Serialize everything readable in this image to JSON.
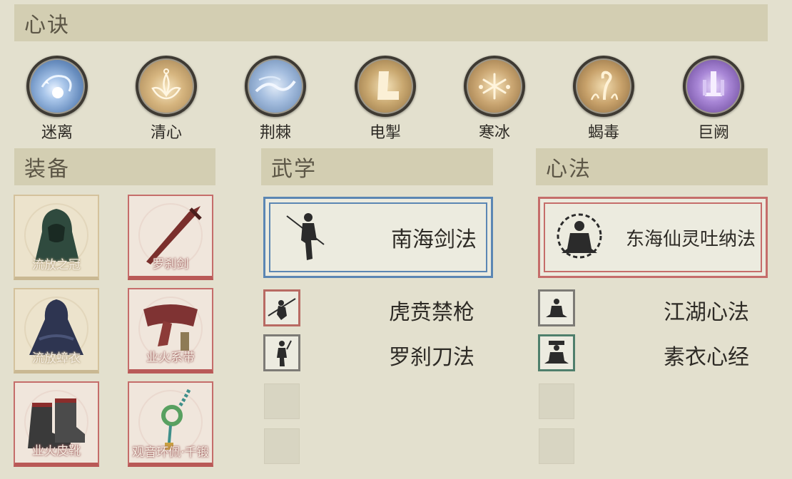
{
  "sections": {
    "xinjue": "心诀",
    "zhuangbei": "装备",
    "wuxue": "武学",
    "xinfa": "心法"
  },
  "skills": [
    {
      "name": "迷离",
      "icon": "swirl-orb-icon",
      "color": "#8fb0d8"
    },
    {
      "name": "清心",
      "icon": "lotus-icon",
      "color": "#c9a870"
    },
    {
      "name": "荆棘",
      "icon": "thorn-vine-icon",
      "color": "#8fb0d8"
    },
    {
      "name": "电掣",
      "icon": "lightning-boot-icon",
      "color": "#c9a870"
    },
    {
      "name": "寒冰",
      "icon": "snowflake-icon",
      "color": "#c9a870"
    },
    {
      "name": "蝎毒",
      "icon": "scorpion-icon",
      "color": "#c9a870"
    },
    {
      "name": "巨阙",
      "icon": "purple-sword-icon",
      "color": "#9b74c7"
    }
  ],
  "equipment": [
    {
      "name": "流放之冠",
      "icon": "hood-icon",
      "frame": "tan"
    },
    {
      "name": "罗刹剑",
      "icon": "sword-icon",
      "frame": "red"
    },
    {
      "name": "流放蟑衣",
      "icon": "cloak-icon",
      "frame": "tan"
    },
    {
      "name": "业火系带",
      "icon": "sash-icon",
      "frame": "red"
    },
    {
      "name": "业火皮靴",
      "icon": "boots-icon",
      "frame": "red"
    },
    {
      "name": "观音环佩·千锻",
      "icon": "jade-pendant-icon",
      "frame": "red"
    }
  ],
  "wuxue": {
    "main": {
      "name": "南海剑法",
      "icon": "swordsman-icon",
      "border": "#5b86b3"
    },
    "rows": [
      {
        "name": "虎贲禁枪",
        "icon": "spear-fighter-icon",
        "border": "#b86a63"
      },
      {
        "name": "罗刹刀法",
        "icon": "blade-fighter-icon",
        "border": "#7d7b76"
      }
    ]
  },
  "xinfa": {
    "main": {
      "name": "东海仙灵吐纳法",
      "icon": "meditating-monk-icon",
      "border": "#c56d6a"
    },
    "rows": [
      {
        "name": "江湖心法",
        "icon": "meditation-icon",
        "border": "#7d7b76"
      },
      {
        "name": "素衣心经",
        "icon": "seated-scholar-icon",
        "border": "#4f7f6c"
      }
    ]
  }
}
